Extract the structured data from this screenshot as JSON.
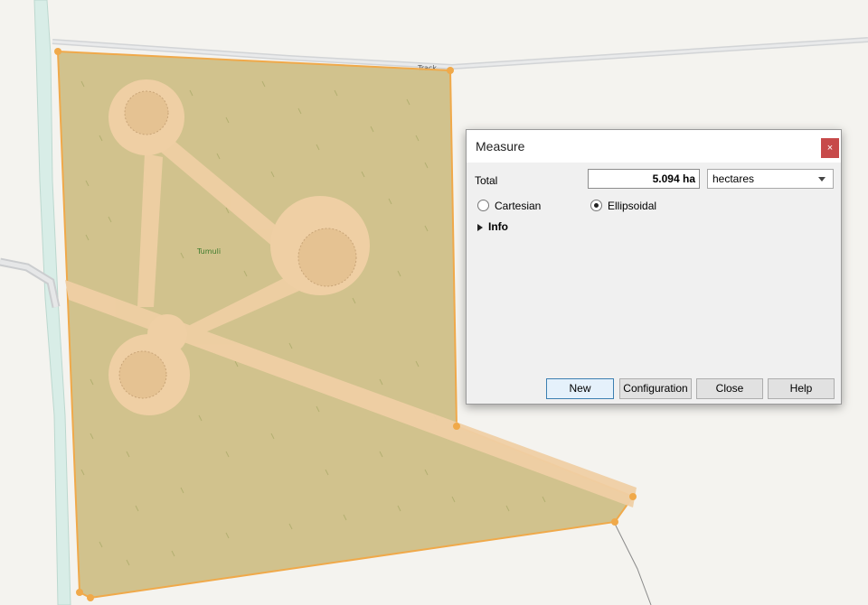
{
  "map": {
    "track_label": "Track",
    "feature_label": "Tumuli"
  },
  "dialog": {
    "title": "Measure",
    "close_glyph": "×",
    "total_label": "Total",
    "total_value": "5.094 ha",
    "units": {
      "selected": "hectares"
    },
    "options": {
      "cartesian": {
        "label": "Cartesian",
        "checked": false
      },
      "ellipsoidal": {
        "label": "Ellipsoidal",
        "checked": true
      }
    },
    "info_label": "Info",
    "buttons": {
      "new_label": "New",
      "configuration_label": "Configuration",
      "close_label": "Close",
      "help_label": "Help"
    }
  },
  "colors": {
    "polygon_fill": "#d2bf86",
    "polygon_stroke": "#f0a94a",
    "vertex": "#f0a94a",
    "path_fill": "#efcfa4",
    "road": "#cbcdcf",
    "water": "#d6ece6",
    "close_button": "#c74a4a"
  }
}
